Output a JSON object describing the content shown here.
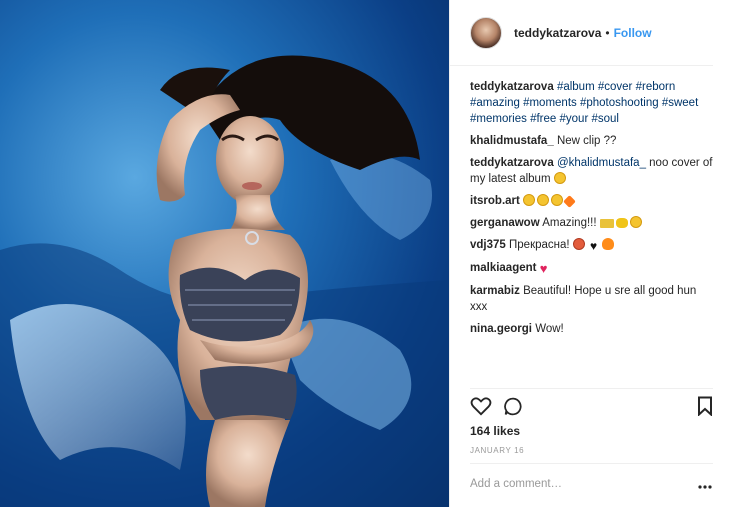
{
  "post": {
    "username": "teddykatzarova",
    "separator": "•",
    "follow_label": "Follow"
  },
  "comments": [
    {
      "author": "teddykatzarova",
      "parts": [
        {
          "type": "tag",
          "text": "#album"
        },
        {
          "type": "text",
          "text": " "
        },
        {
          "type": "tag",
          "text": "#cover"
        },
        {
          "type": "text",
          "text": " "
        },
        {
          "type": "tag",
          "text": "#reborn"
        },
        {
          "type": "text",
          "text": " "
        },
        {
          "type": "tag",
          "text": "#amazing"
        },
        {
          "type": "text",
          "text": " "
        },
        {
          "type": "tag",
          "text": "#moments"
        },
        {
          "type": "text",
          "text": " "
        },
        {
          "type": "tag",
          "text": "#photoshooting"
        },
        {
          "type": "text",
          "text": " "
        },
        {
          "type": "tag",
          "text": "#sweet"
        },
        {
          "type": "text",
          "text": " "
        },
        {
          "type": "tag",
          "text": "#memories"
        },
        {
          "type": "text",
          "text": " "
        },
        {
          "type": "tag",
          "text": "#free"
        },
        {
          "type": "text",
          "text": " "
        },
        {
          "type": "tag",
          "text": "#your"
        },
        {
          "type": "text",
          "text": " "
        },
        {
          "type": "tag",
          "text": "#soul"
        }
      ]
    },
    {
      "author": "khalidmustafa_",
      "parts": [
        {
          "type": "text",
          "text": "New clip ??"
        }
      ]
    },
    {
      "author": "teddykatzarova",
      "parts": [
        {
          "type": "tag",
          "text": "@khalidmustafa_"
        },
        {
          "type": "text",
          "text": " noo cover of my latest album "
        },
        {
          "type": "emoji",
          "icon": "sweat-smile-emoji",
          "cls": "e-sweat"
        }
      ]
    },
    {
      "author": "itsrob.art",
      "parts": [
        {
          "type": "emoji",
          "icon": "heart-eyes-emoji",
          "cls": "e-heart-eyes"
        },
        {
          "type": "emoji",
          "icon": "heart-eyes-emoji",
          "cls": "e-heart-eyes"
        },
        {
          "type": "emoji",
          "icon": "heart-eyes-emoji",
          "cls": "e-heart-eyes"
        },
        {
          "type": "emoji",
          "icon": "collision-emoji",
          "cls": "e-boom"
        }
      ]
    },
    {
      "author": "gerganawow",
      "parts": [
        {
          "type": "text",
          "text": "Amazing!!! "
        },
        {
          "type": "emoji",
          "icon": "money-emoji",
          "cls": "e-money"
        },
        {
          "type": "emoji",
          "icon": "bee-emoji",
          "cls": "e-bee"
        },
        {
          "type": "emoji",
          "icon": "heart-eyes-emoji",
          "cls": "e-heart-eyes"
        }
      ]
    },
    {
      "author": "vdj375",
      "parts": [
        {
          "type": "text",
          "text": "Прекрасна! "
        },
        {
          "type": "emoji",
          "icon": "angry-emoji",
          "cls": "e-angry"
        },
        {
          "type": "text",
          "text": " "
        },
        {
          "type": "emoji",
          "icon": "black-heart-emoji",
          "cls": "e-bheart",
          "glyph": "♥"
        },
        {
          "type": "text",
          "text": " "
        },
        {
          "type": "emoji",
          "icon": "fire-emoji",
          "cls": "e-fire"
        }
      ]
    },
    {
      "author": "malkiaagent",
      "parts": [
        {
          "type": "emoji",
          "icon": "red-heart-emoji",
          "cls": "e-heart",
          "glyph": "♥"
        }
      ]
    },
    {
      "author": "karmabiz",
      "parts": [
        {
          "type": "text",
          "text": "Beautiful! Hope u sre all good hun xxx"
        }
      ]
    },
    {
      "author": "nina.georgi",
      "parts": [
        {
          "type": "text",
          "text": "Wow!"
        }
      ]
    }
  ],
  "stats": {
    "likes": "164 likes",
    "date": "JANUARY 16"
  },
  "input": {
    "placeholder": "Add a comment…"
  },
  "icons": {
    "like": "heart-outline-icon",
    "comment": "comment-bubble-icon",
    "save": "bookmark-icon",
    "more": "more-options-icon"
  },
  "colors": {
    "link": "#003569",
    "follow": "#3897f0",
    "text": "#262626",
    "muted": "#999999"
  }
}
